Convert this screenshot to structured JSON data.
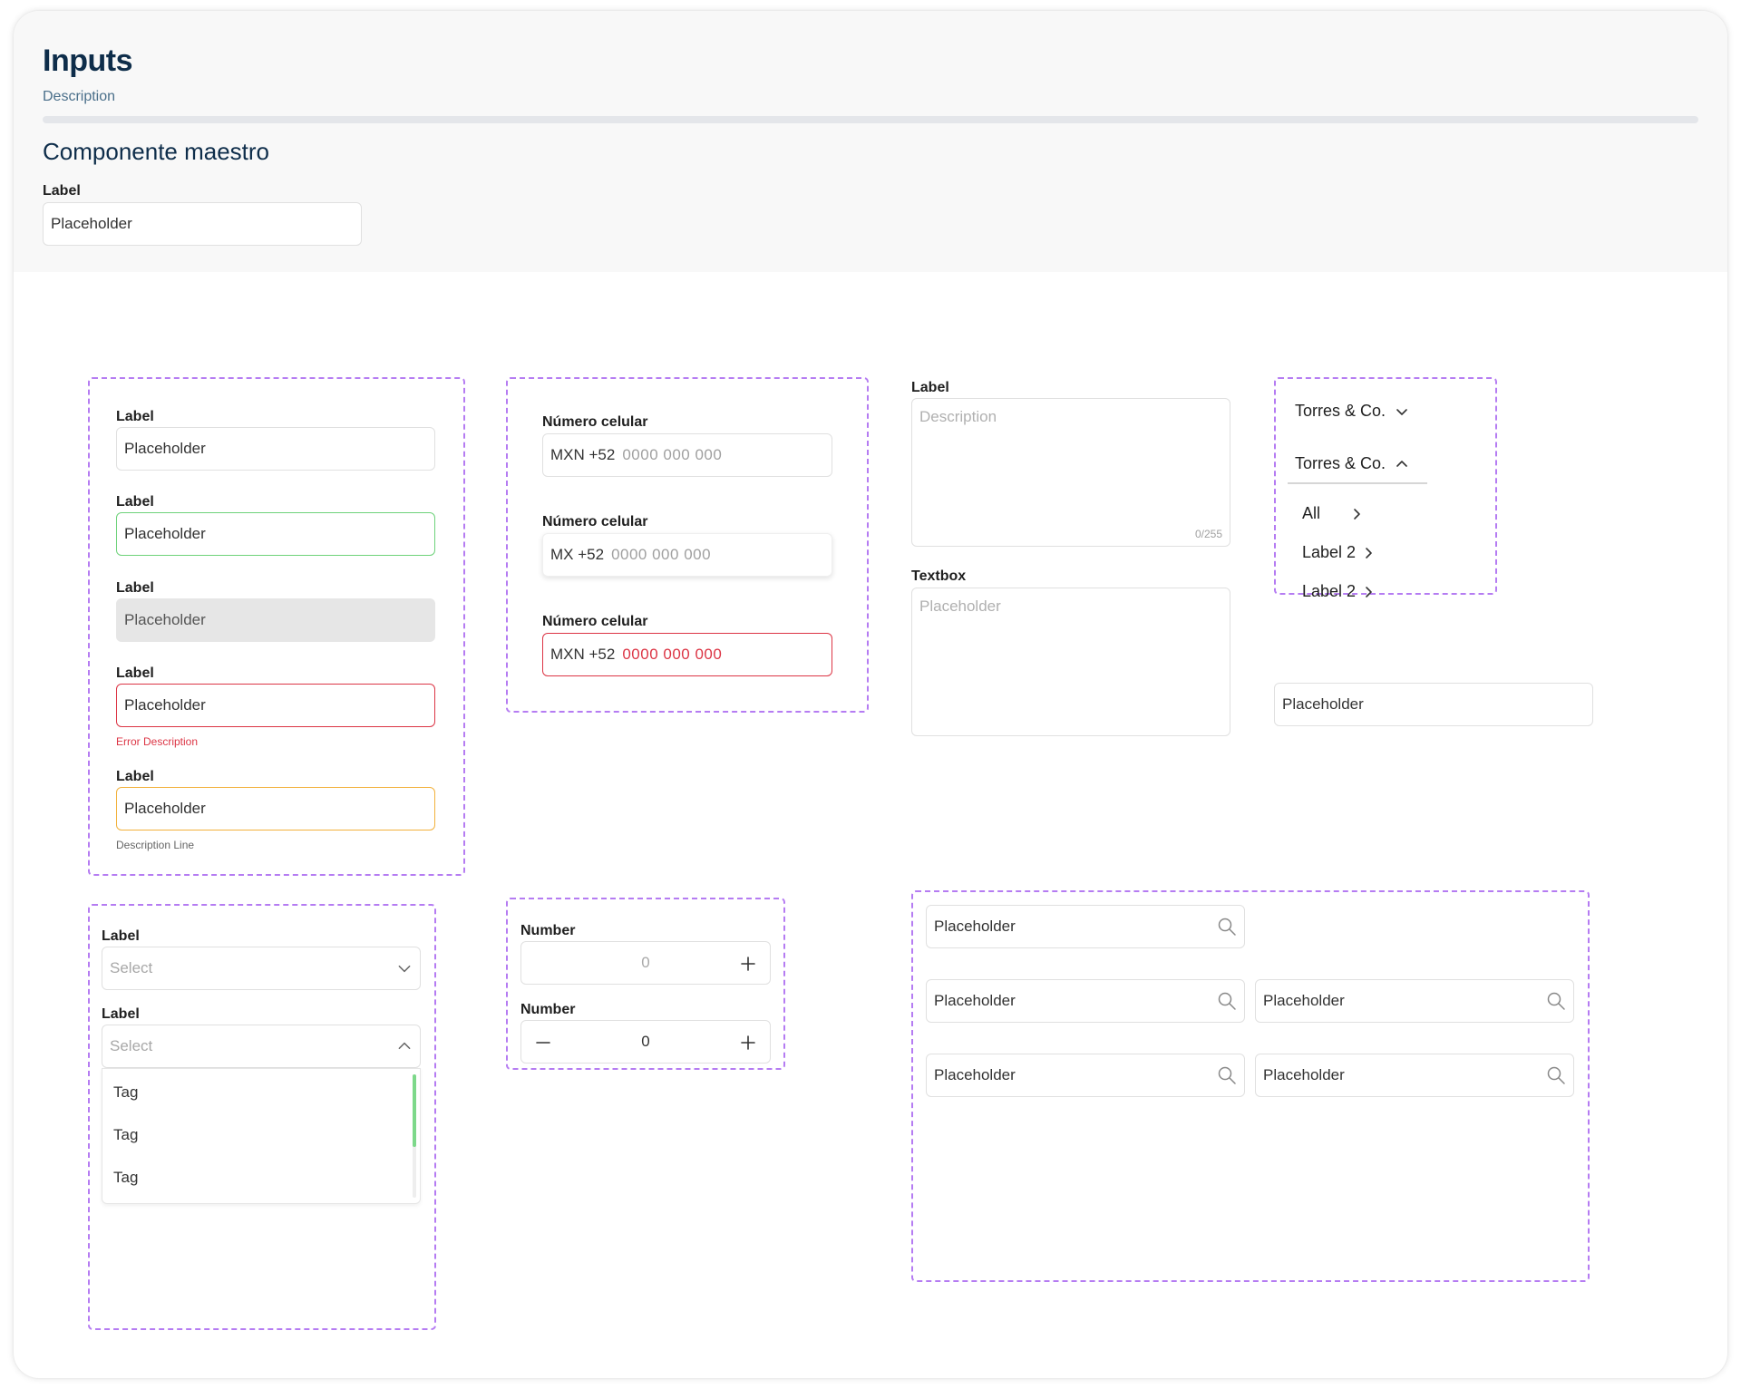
{
  "header": {
    "title": "Inputs",
    "description": "Description",
    "section_title": "Componente maestro",
    "master_label": "Label",
    "master_placeholder": "Placeholder"
  },
  "text_inputs": [
    {
      "label": "Label",
      "placeholder": "Placeholder",
      "state": "default"
    },
    {
      "label": "Label",
      "placeholder": "Placeholder",
      "state": "focus"
    },
    {
      "label": "Label",
      "placeholder": "Placeholder",
      "state": "disabled"
    },
    {
      "label": "Label",
      "placeholder": "Placeholder",
      "state": "error",
      "help": "Error Description"
    },
    {
      "label": "Label",
      "placeholder": "Placeholder",
      "state": "warning",
      "help": "Description Line"
    }
  ],
  "phone_inputs": [
    {
      "label": "Número celular",
      "prefix": "MXN +52",
      "number": "0000 000 000",
      "state": "default"
    },
    {
      "label": "Número celular",
      "prefix": "MX +52",
      "number": "0000 000 000",
      "state": "active"
    },
    {
      "label": "Número celular",
      "prefix": "MXN +52",
      "number": "0000 000 000",
      "state": "error"
    }
  ],
  "textareas": [
    {
      "label": "Label",
      "placeholder": "Description",
      "counter": "0/255"
    },
    {
      "label": "Textbox",
      "placeholder": "Placeholder"
    }
  ],
  "company_menu": {
    "collapsed_label": "Torres & Co.",
    "expanded_label": "Torres & Co.",
    "items": [
      "All",
      "Label 2",
      "Label 2"
    ]
  },
  "standalone_input": {
    "placeholder": "Placeholder"
  },
  "selects": [
    {
      "label": "Label",
      "placeholder": "Select",
      "open": false
    },
    {
      "label": "Label",
      "placeholder": "Select",
      "open": true,
      "options": [
        "Tag",
        "Tag",
        "Tag"
      ]
    }
  ],
  "number_inputs": [
    {
      "label": "Number",
      "value": "0",
      "has_minus": false
    },
    {
      "label": "Number",
      "value": "0",
      "has_minus": true
    }
  ],
  "search_inputs": [
    {
      "placeholder": "Placeholder"
    },
    {
      "placeholder": "Placeholder"
    },
    {
      "placeholder": "Placeholder"
    },
    {
      "placeholder": "Placeholder"
    },
    {
      "placeholder": "Placeholder"
    }
  ],
  "colors": {
    "title": "#0e2d4a",
    "dashed_frame": "#b57cf2",
    "focus": "#6ed27a",
    "error": "#dc3545",
    "warning": "#f2b13c",
    "disabled_bg": "#e6e6e6"
  },
  "icons": {
    "chevron_down": "chevron-down-icon",
    "chevron_up": "chevron-up-icon",
    "chevron_right": "chevron-right-icon",
    "search": "search-icon",
    "plus": "plus-icon",
    "minus": "minus-icon"
  }
}
